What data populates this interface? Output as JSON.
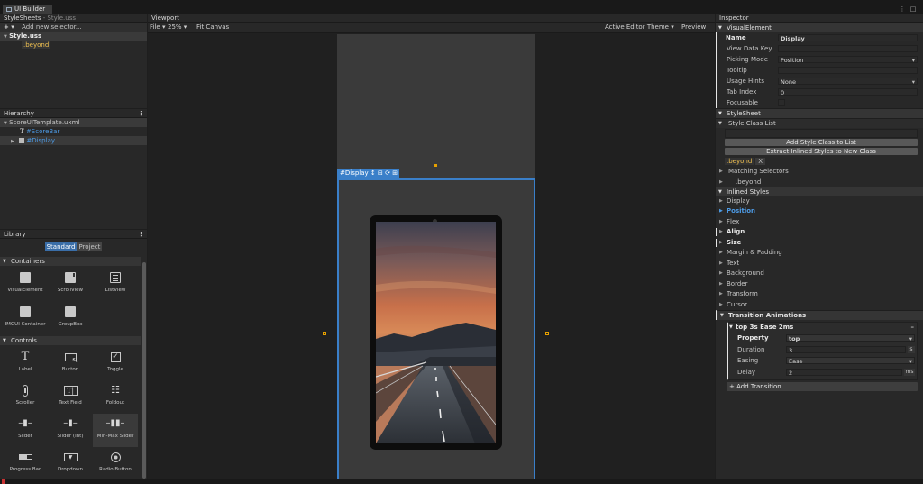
{
  "app": {
    "tab_title": "UI Builder"
  },
  "stylesheets": {
    "header": "StyleSheets",
    "file_hint": "- Style.uss",
    "add_selector_placeholder": "Add new selector...",
    "file": "Style.uss",
    "selector": ".beyond"
  },
  "hierarchy": {
    "header": "Hierarchy",
    "root": "ScoreUITemplate.uxml",
    "items": [
      "#ScoreBar",
      "#Display"
    ]
  },
  "library": {
    "header": "Library",
    "tabs": [
      "Standard",
      "Project"
    ],
    "containers_label": "Containers",
    "containers": [
      "VisualElement",
      "ScrollView",
      "ListView",
      "IMGUI Container",
      "GroupBox"
    ],
    "controls_label": "Controls",
    "controls": [
      "Label",
      "Button",
      "Toggle",
      "Scroller",
      "Text Field",
      "Foldout",
      "Slider",
      "Slider (Int)",
      "Min-Max Slider",
      "Progress Bar",
      "Dropdown",
      "Radio Button"
    ]
  },
  "viewport": {
    "header": "Viewport",
    "file_menu": "File",
    "zoom": "25%",
    "fit_canvas": "Fit Canvas",
    "theme": "Active Editor Theme",
    "preview": "Preview",
    "selected_tag": "#Display"
  },
  "inspector": {
    "header": "Inspector",
    "visual_element_label": "VisualElement",
    "name_label": "Name",
    "name_value": "Display",
    "view_data_key_label": "View Data Key",
    "picking_mode_label": "Picking Mode",
    "picking_mode_value": "Position",
    "tooltip_label": "Tooltip",
    "usage_hints_label": "Usage Hints",
    "usage_hints_value": "None",
    "tab_index_label": "Tab Index",
    "tab_index_value": "0",
    "focusable_label": "Focusable",
    "stylesheet_label": "StyleSheet",
    "style_class_list_label": "Style Class List",
    "add_style_class_button": "Add Style Class to List",
    "extract_button": "Extract Inlined Styles to New Class",
    "class_chip": ".beyond",
    "class_chip_remove": "X",
    "matching_selectors_label": "Matching Selectors",
    "matching_selector": ".beyond",
    "inlined_styles_label": "Inlined Styles",
    "style_sections": [
      "Display",
      "Position",
      "Flex",
      "Align",
      "Size",
      "Margin & Padding",
      "Text",
      "Background",
      "Border",
      "Transform",
      "Cursor"
    ],
    "transition_label": "Transition Animations",
    "transition_item": "top 3s Ease 2ms",
    "property_label": "Property",
    "property_value": "top",
    "duration_label": "Duration",
    "duration_value": "3",
    "duration_unit": "s",
    "easing_label": "Easing",
    "easing_value": "Ease",
    "delay_label": "Delay",
    "delay_value": "2",
    "delay_unit": "ms",
    "add_transition_button": "+ Add Transition"
  },
  "colors": {
    "accent": "#4d9be6",
    "selection_frame": "#3a7fc9",
    "warning": "#c83232"
  }
}
